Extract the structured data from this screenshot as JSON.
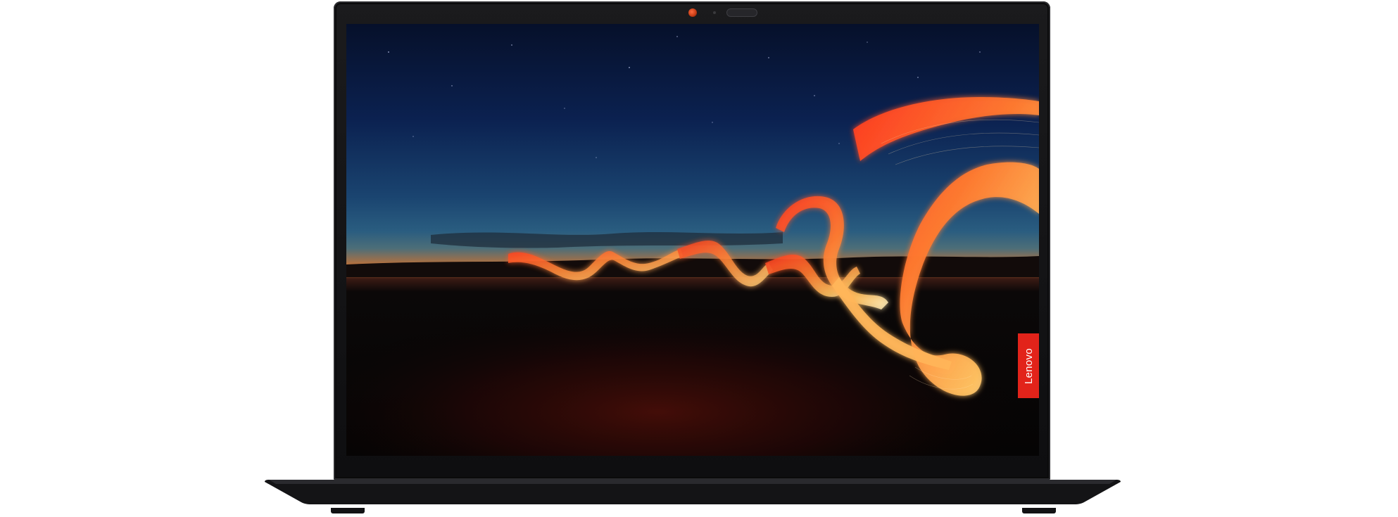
{
  "brand": {
    "label": "Lenovo",
    "badge_color": "#e2231a"
  },
  "device": {
    "body_color": "#0e0e10",
    "camera_indicator_color": "#c23a14"
  },
  "screen": {
    "wallpaper": "night-sky-light-painting",
    "sky_top_color": "#0a1e4a",
    "horizon_color": "#e07a2a",
    "light_trail_color": "#ff5a2a"
  }
}
